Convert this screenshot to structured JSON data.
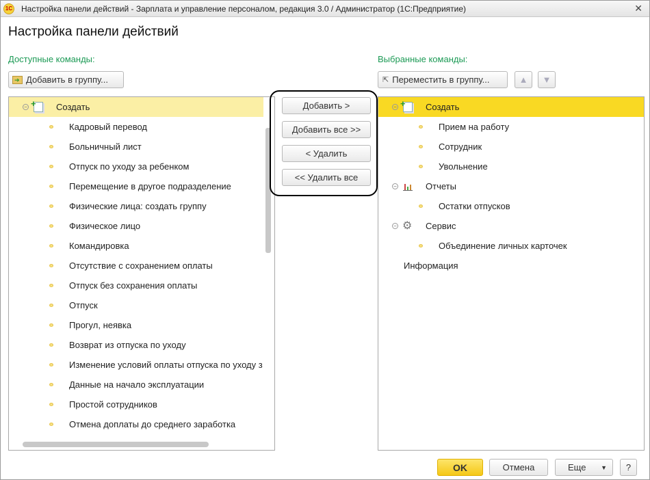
{
  "window": {
    "title": "Настройка панели действий - Зарплата и управление персоналом, редакция 3.0 / Администратор  (1С:Предприятие)",
    "logo": "1С",
    "close": "✕"
  },
  "heading": "Настройка панели действий",
  "left": {
    "label": "Доступные команды:",
    "add_to_group": "Добавить в группу...",
    "group": "Создать",
    "items": [
      "Кадровый перевод",
      "Больничный лист",
      "Отпуск по уходу за ребенком",
      "Перемещение в другое подразделение",
      "Физические лица: создать группу",
      "Физическое лицо",
      "Командировка",
      "Отсутствие с сохранением оплаты",
      "Отпуск без сохранения оплаты",
      "Отпуск",
      "Прогул, неявка",
      "Возврат из отпуска по уходу",
      "Изменение условий оплаты отпуска по уходу з",
      "Данные на начало эксплуатации",
      "Простой сотрудников",
      "Отмена доплаты до среднего заработка"
    ]
  },
  "middle": {
    "add": "Добавить >",
    "add_all": "Добавить все >>",
    "remove": "< Удалить",
    "remove_all": "<< Удалить все"
  },
  "right": {
    "label": "Выбранные команды:",
    "move_to_group": "Переместить в группу...",
    "groups": [
      {
        "name": "Создать",
        "icon": "create-icon",
        "items": [
          "Прием на работу",
          "Сотрудник",
          "Увольнение"
        ]
      },
      {
        "name": "Отчеты",
        "icon": "chart-icon",
        "items": [
          "Остатки отпусков"
        ]
      },
      {
        "name": "Сервис",
        "icon": "gear-icon",
        "items": [
          "Объединение личных карточек"
        ]
      }
    ],
    "extra": "Информация"
  },
  "footer": {
    "ok": "OK",
    "cancel": "Отмена",
    "more": "Еще",
    "help": "?"
  },
  "colors": {
    "selected_active": "#f9d923",
    "selected_inactive": "#fbefa5",
    "accent_label": "#1c9a55"
  }
}
